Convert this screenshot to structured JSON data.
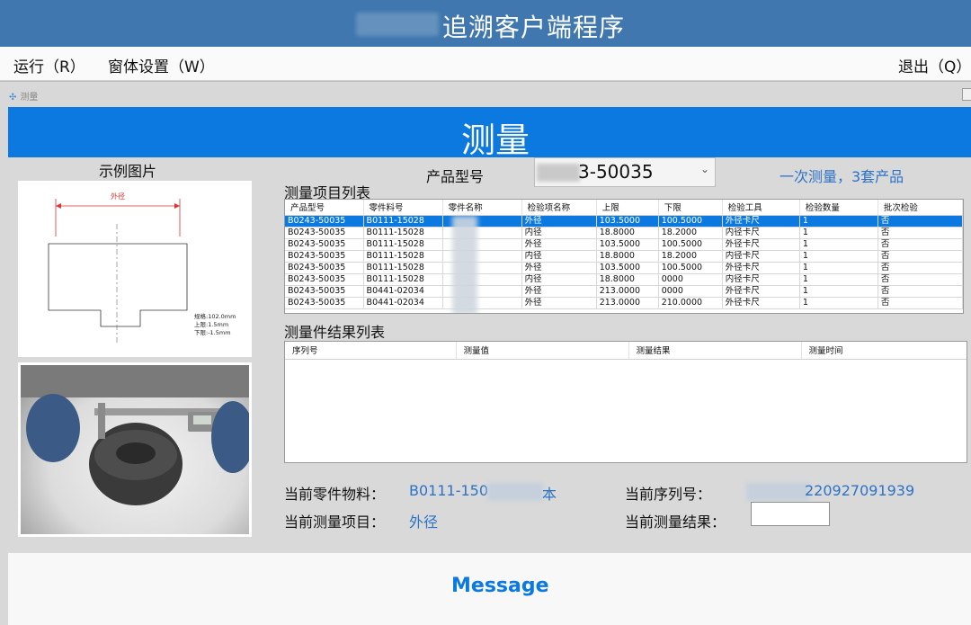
{
  "app": {
    "title": "追溯客户端程序"
  },
  "menu": {
    "run": "运行（R）",
    "window_settings": "窗体设置（W）",
    "exit": "退出（Q）"
  },
  "child_window": {
    "title": "测量",
    "banner": "测量"
  },
  "left_panel": {
    "example_label": "示例图片",
    "drawing": {
      "dimension_label": "外径",
      "spec": "规格:102.0mm",
      "upper": "上限:1.5mm",
      "lower": "下限:-1.5mm"
    }
  },
  "product": {
    "label": "产品型号",
    "selected_value": "3-50035",
    "mode_text": "一次测量，3套产品"
  },
  "items_table": {
    "label": "测量项目列表",
    "columns": [
      "产品型号",
      "零件料号",
      "零件名称",
      "检验项名称",
      "上限",
      "下限",
      "检验工具",
      "检验数量",
      "批次检验"
    ],
    "rows": [
      [
        "B0243-50035",
        "B0111-15028",
        "",
        "外径",
        "103.5000",
        "100.5000",
        "外径卡尺",
        "1",
        "否"
      ],
      [
        "B0243-50035",
        "B0111-15028",
        "",
        "内径",
        "18.8000",
        "18.2000",
        "内径卡尺",
        "1",
        "否"
      ],
      [
        "B0243-50035",
        "B0111-15028",
        "",
        "外径",
        "103.5000",
        "100.5000",
        "外径卡尺",
        "1",
        "否"
      ],
      [
        "B0243-50035",
        "B0111-15028",
        "",
        "内径",
        "18.8000",
        "18.2000",
        "内径卡尺",
        "1",
        "否"
      ],
      [
        "B0243-50035",
        "B0111-15028",
        "",
        "外径",
        "103.5000",
        "100.5000",
        "外径卡尺",
        "1",
        "否"
      ],
      [
        "B0243-50035",
        "B0111-15028",
        "",
        "内径",
        "18.8000",
        "0000",
        "内径卡尺",
        "1",
        "否"
      ],
      [
        "B0243-50035",
        "B0441-02034",
        "",
        "外径",
        "213.0000",
        "0000",
        "外径卡尺",
        "1",
        "否"
      ],
      [
        "B0243-50035",
        "B0441-02034",
        "",
        "外径",
        "213.0000",
        "210.0000",
        "外径卡尺",
        "1",
        "否"
      ]
    ]
  },
  "results_table": {
    "label": "测量件结果列表",
    "columns": [
      "序列号",
      "测量值",
      "测量结果",
      "测量时间"
    ]
  },
  "info": {
    "current_material_label": "当前零件物料：",
    "current_material_value_a": "B0111-150",
    "current_material_value_b": "本",
    "current_serial_label": "当前序列号：",
    "current_serial_value": "220927091939",
    "current_item_label": "当前测量项目：",
    "current_item_value": "外径",
    "current_result_label": "当前测量结果："
  },
  "message": {
    "text": "Message"
  }
}
